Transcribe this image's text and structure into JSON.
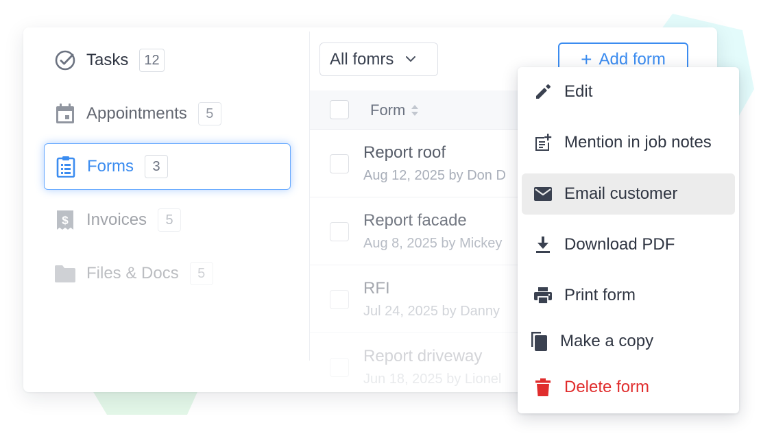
{
  "sidebar": {
    "items": [
      {
        "label": "Tasks",
        "count": "12",
        "icon": "check-circle-icon"
      },
      {
        "label": "Appointments",
        "count": "5",
        "icon": "calendar-icon"
      },
      {
        "label": "Forms",
        "count": "3",
        "icon": "clipboard-list-icon"
      },
      {
        "label": "Invoices",
        "count": "5",
        "icon": "receipt-dollar-icon"
      },
      {
        "label": "Files & Docs",
        "count": "5",
        "icon": "folder-icon"
      }
    ],
    "active_index": 2
  },
  "toolbar": {
    "filter_label": "All fomrs",
    "add_label": "Add form"
  },
  "table": {
    "column_header": "Form",
    "rows": [
      {
        "title": "Report roof",
        "meta": "Aug 12, 2025 by Don D"
      },
      {
        "title": "Report facade",
        "meta": "Aug 8, 2025 by Mickey"
      },
      {
        "title": "RFI",
        "meta": "Jul 24, 2025 by Danny"
      },
      {
        "title": "Report driveway",
        "meta": "Jun 18, 2025 by Lionel"
      }
    ]
  },
  "menu": {
    "items": [
      {
        "label": "Edit",
        "icon": "pencil-icon"
      },
      {
        "label": "Mention in job notes",
        "icon": "note-add-icon"
      },
      {
        "label": "Email customer",
        "icon": "envelope-icon"
      },
      {
        "label": "Download PDF",
        "icon": "download-icon"
      },
      {
        "label": "Print form",
        "icon": "printer-icon"
      },
      {
        "label": "Make a copy",
        "icon": "copy-icon"
      },
      {
        "label": "Delete form",
        "icon": "trash-icon"
      }
    ],
    "hover_index": 2
  },
  "colors": {
    "accent": "#3b8cf0",
    "danger": "#e02d2d",
    "icon_gray": "#6b7280",
    "icon_dark": "#3a4150"
  }
}
